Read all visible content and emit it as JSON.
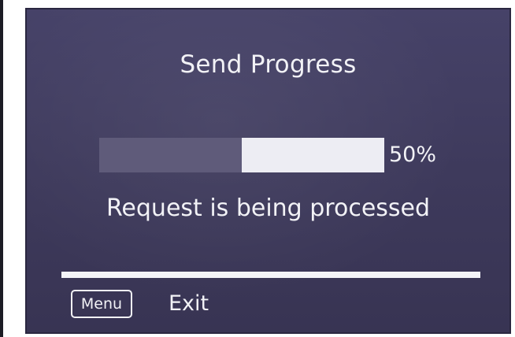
{
  "dialog": {
    "title": "Send Progress",
    "progress": {
      "percent_label": "50%",
      "value": 0.5
    },
    "status_text": "Request is being processed"
  },
  "footer": {
    "menu_key_label": "Menu",
    "exit_label": "Exit"
  },
  "colors": {
    "screen_background": "#403c60",
    "progress_track": "#5f5b7a",
    "progress_fill": "#ededf3",
    "text": "#f2f2f6"
  }
}
